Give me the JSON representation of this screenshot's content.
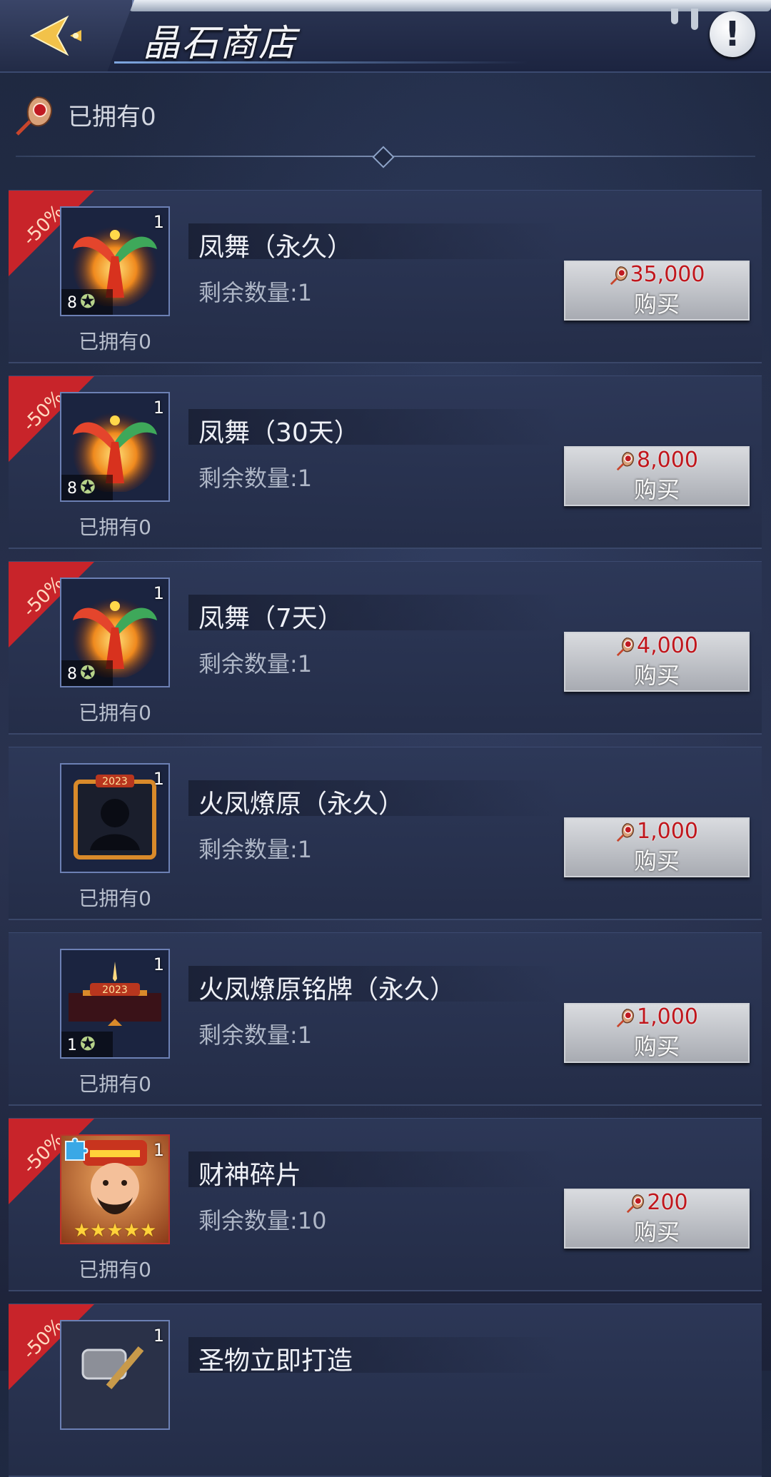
{
  "header": {
    "title": "晶石商店",
    "back_icon": "back-arrow-icon",
    "info_icon": "info-exclamation-icon"
  },
  "owned_bar": {
    "currency_icon": "crystal-gem-icon",
    "text": "已拥有0"
  },
  "items": [
    {
      "discount": "-50%",
      "count": "1",
      "stars": "8",
      "owned": "已拥有0",
      "name": "凤舞（永久）",
      "remaining": "剩余数量:1",
      "price": "35,000",
      "buy_label": "购买",
      "icon": "phoenix-wings-icon"
    },
    {
      "discount": "-50%",
      "count": "1",
      "stars": "8",
      "owned": "已拥有0",
      "name": "凤舞（30天）",
      "remaining": "剩余数量:1",
      "price": "8,000",
      "buy_label": "购买",
      "icon": "phoenix-wings-icon"
    },
    {
      "discount": "-50%",
      "count": "1",
      "stars": "8",
      "owned": "已拥有0",
      "name": "凤舞（7天）",
      "remaining": "剩余数量:1",
      "price": "4,000",
      "buy_label": "购买",
      "icon": "phoenix-wings-icon"
    },
    {
      "discount": "",
      "count": "1",
      "stars": "",
      "owned": "已拥有0",
      "name": "火凤燎原（永久）",
      "remaining": "剩余数量:1",
      "price": "1,000",
      "buy_label": "购买",
      "icon": "avatar-frame-2023-icon",
      "frame_text": "2023"
    },
    {
      "discount": "",
      "count": "1",
      "stars": "1",
      "owned": "已拥有0",
      "name": "火凤燎原铭牌（永久）",
      "remaining": "剩余数量:1",
      "price": "1,000",
      "buy_label": "购买",
      "icon": "nameplate-2023-icon",
      "frame_text": "2023"
    },
    {
      "discount": "-50%",
      "count": "1",
      "stars": "",
      "owned": "已拥有0",
      "name": "财神碎片",
      "remaining": "剩余数量:10",
      "price": "200",
      "buy_label": "购买",
      "icon": "god-of-wealth-fragment-icon",
      "rating_stars": 5
    },
    {
      "discount": "-50%",
      "count": "1",
      "stars": "",
      "owned": "",
      "name": "圣物立即打造",
      "remaining": "",
      "price": "",
      "buy_label": "",
      "icon": "forge-hammer-icon"
    }
  ],
  "colors": {
    "discount_ribbon": "#c8242a",
    "price_text": "#c0161c",
    "background": "#232c46"
  }
}
